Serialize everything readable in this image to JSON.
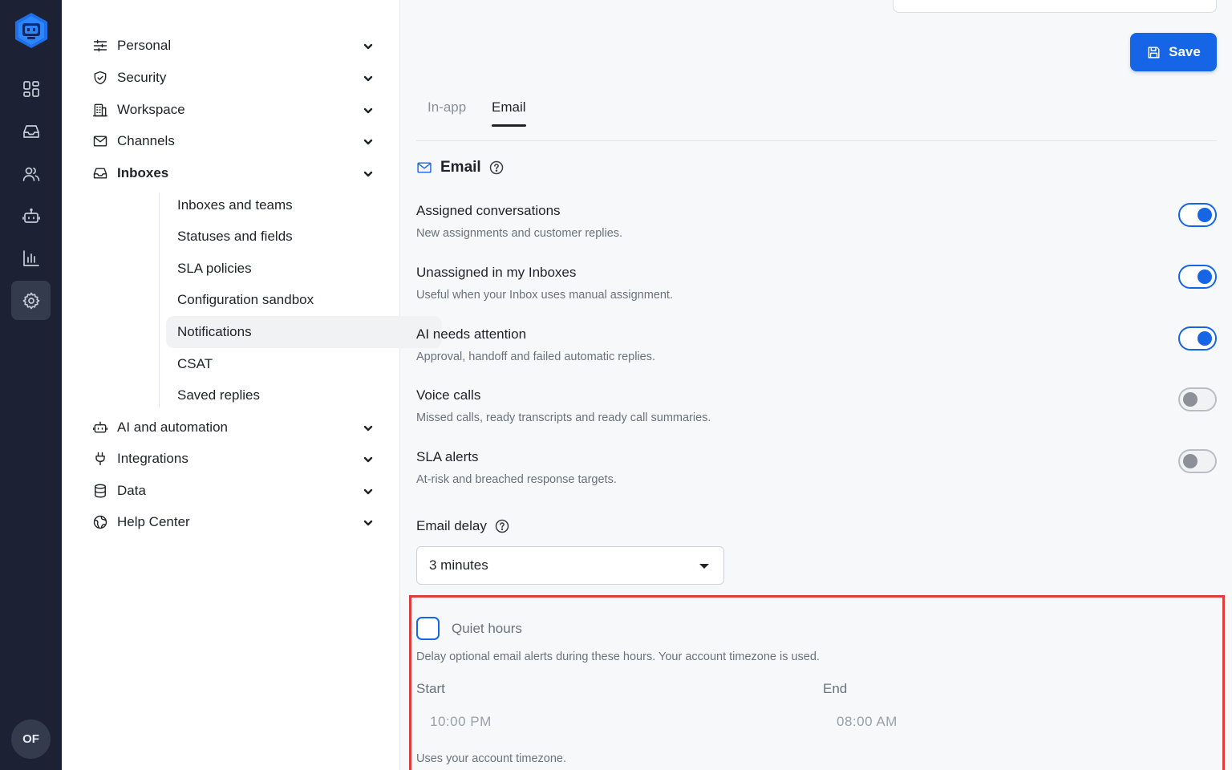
{
  "rail": {
    "items": [
      "dashboard-icon",
      "inbox-icon",
      "contacts-icon",
      "bot-icon",
      "reports-icon",
      "settings-icon"
    ],
    "active": "settings-icon",
    "avatar_initials": "OF"
  },
  "sidebar": {
    "items": [
      {
        "label": "Personal",
        "icon": "sliders-icon"
      },
      {
        "label": "Security",
        "icon": "shield-icon"
      },
      {
        "label": "Workspace",
        "icon": "building-icon"
      },
      {
        "label": "Channels",
        "icon": "mail-icon"
      },
      {
        "label": "Inboxes",
        "icon": "inbox-icon"
      },
      {
        "label": "AI and automation",
        "icon": "bot-icon"
      },
      {
        "label": "Integrations",
        "icon": "plug-icon"
      },
      {
        "label": "Data",
        "icon": "database-icon"
      },
      {
        "label": "Help Center",
        "icon": "globe-icon"
      }
    ],
    "inboxes_subitems": [
      "Inboxes and teams",
      "Statuses and fields",
      "SLA policies",
      "Configuration sandbox",
      "Notifications",
      "CSAT",
      "Saved replies"
    ],
    "active_subitem": "Notifications"
  },
  "header": {
    "save_label": "Save"
  },
  "tabs": [
    {
      "label": "In-app",
      "active": false
    },
    {
      "label": "Email",
      "active": true
    }
  ],
  "section": {
    "title": "Email"
  },
  "preferences": [
    {
      "title": "Assigned conversations",
      "desc": "New assignments and customer replies.",
      "enabled": true
    },
    {
      "title": "Unassigned in my Inboxes",
      "desc": "Useful when your Inbox uses manual assignment.",
      "enabled": true
    },
    {
      "title": "AI needs attention",
      "desc": "Approval, handoff and failed automatic replies.",
      "enabled": true
    },
    {
      "title": "Voice calls",
      "desc": "Missed calls, ready transcripts and ready call summaries.",
      "enabled": false
    },
    {
      "title": "SLA alerts",
      "desc": "At-risk and breached response targets.",
      "enabled": false
    }
  ],
  "email_delay": {
    "label": "Email delay",
    "value": "3 minutes"
  },
  "quiet_hours": {
    "label": "Quiet hours",
    "checked": false,
    "desc": "Delay optional email alerts during these hours. Your account timezone is used.",
    "start_label": "Start",
    "start_value": "10:00 PM",
    "end_label": "End",
    "end_value": "08:00 AM",
    "footnote": "Uses your account timezone."
  },
  "colors": {
    "accent": "#1565e6",
    "rail_bg": "#1c2233",
    "highlight_border": "#e23b3b"
  }
}
